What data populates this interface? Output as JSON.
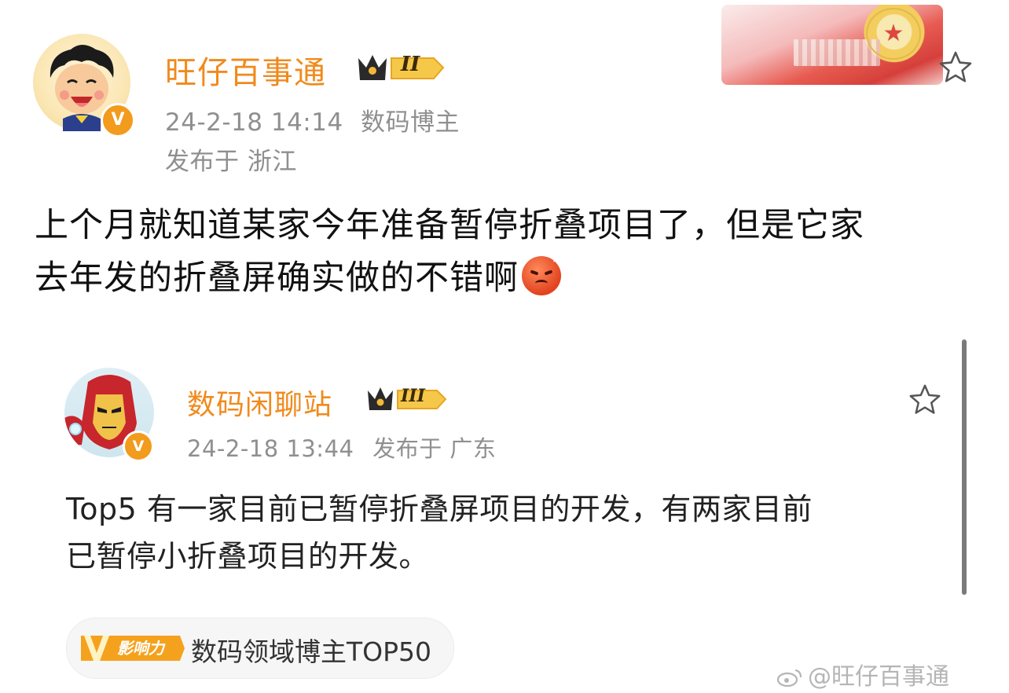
{
  "post": {
    "author": {
      "name": "旺仔百事通",
      "level_badge": "II",
      "verified_badge": "V"
    },
    "meta": {
      "time": "24-2-18 14:14",
      "role": "数码博主",
      "location": "发布于 浙江"
    },
    "text_line1": "上个月就知道某家今年准备暂停折叠项目了，但是它家",
    "text_line2": "去年发的折叠屏确实做的不错啊",
    "emoji": "angry-face-icon"
  },
  "quoted_post": {
    "author": {
      "name": "数码闲聊站",
      "level_badge": "III",
      "verified_badge": "V"
    },
    "meta": {
      "time": "24-2-18 13:44",
      "location": "发布于 广东"
    },
    "text_line1": "Top5 有一家目前已暂停折叠屏项目的开发，有两家目前",
    "text_line2": "已暂停小折叠项目的开发。"
  },
  "influence_tag": {
    "badge_text": "影响力",
    "label": "数码领域博主TOP50"
  },
  "watermark": "@旺仔百事通",
  "colors": {
    "username": "#f08a1c",
    "meta": "#8f8f8f",
    "verified": "#f29b1c",
    "text": "#111111"
  }
}
